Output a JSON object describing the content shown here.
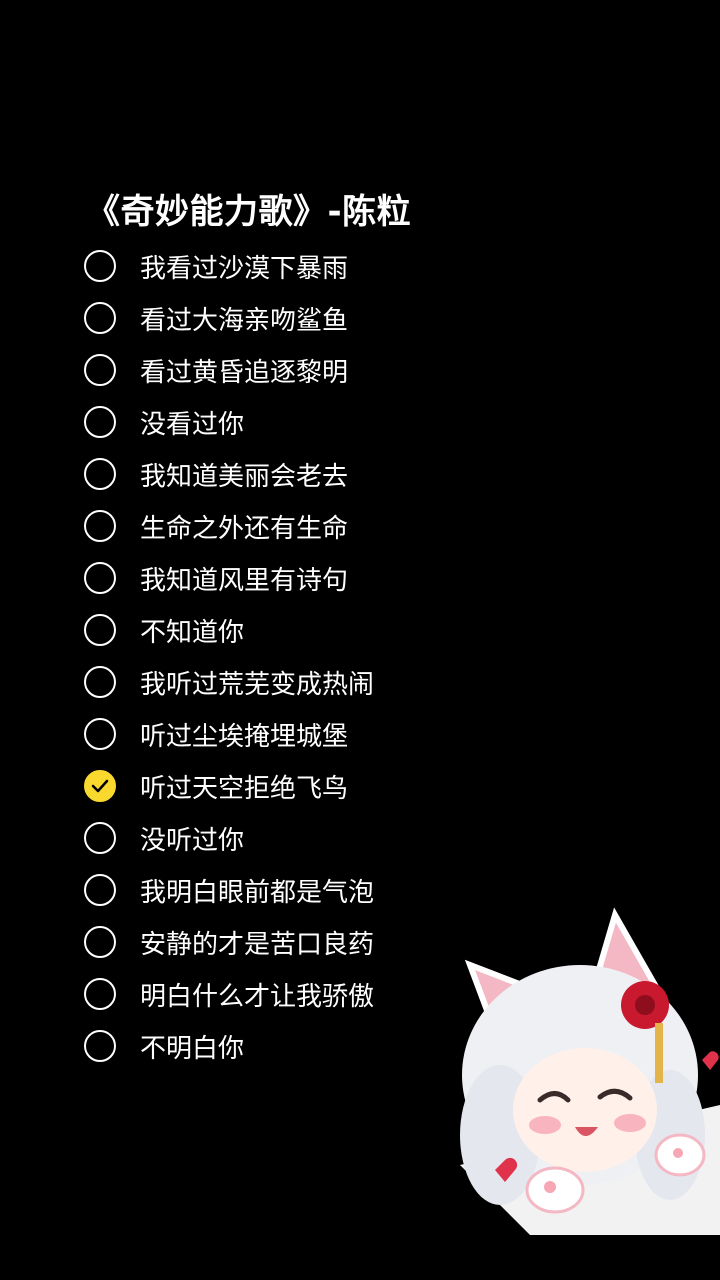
{
  "title": "《奇妙能力歌》-陈粒",
  "items": [
    {
      "label": "我看过沙漠下暴雨",
      "checked": false
    },
    {
      "label": "看过大海亲吻鲨鱼",
      "checked": false
    },
    {
      "label": "看过黄昏追逐黎明",
      "checked": false
    },
    {
      "label": "没看过你",
      "checked": false
    },
    {
      "label": "我知道美丽会老去",
      "checked": false
    },
    {
      "label": "生命之外还有生命",
      "checked": false
    },
    {
      "label": "我知道风里有诗句",
      "checked": false
    },
    {
      "label": "不知道你",
      "checked": false
    },
    {
      "label": "我听过荒芜变成热闹",
      "checked": false
    },
    {
      "label": "听过尘埃掩埋城堡",
      "checked": false
    },
    {
      "label": "听过天空拒绝飞鸟",
      "checked": true
    },
    {
      "label": "没听过你",
      "checked": false
    },
    {
      "label": "我明白眼前都是气泡",
      "checked": false
    },
    {
      "label": "安静的才是苦口良药",
      "checked": false
    },
    {
      "label": "明白什么才让我骄傲",
      "checked": false
    },
    {
      "label": "不明白你",
      "checked": false
    }
  ],
  "colors": {
    "background": "#000000",
    "text": "#ffffff",
    "check_accent": "#f9d92d"
  },
  "sticker": {
    "icon": "anime-cat-girl-sticker"
  }
}
